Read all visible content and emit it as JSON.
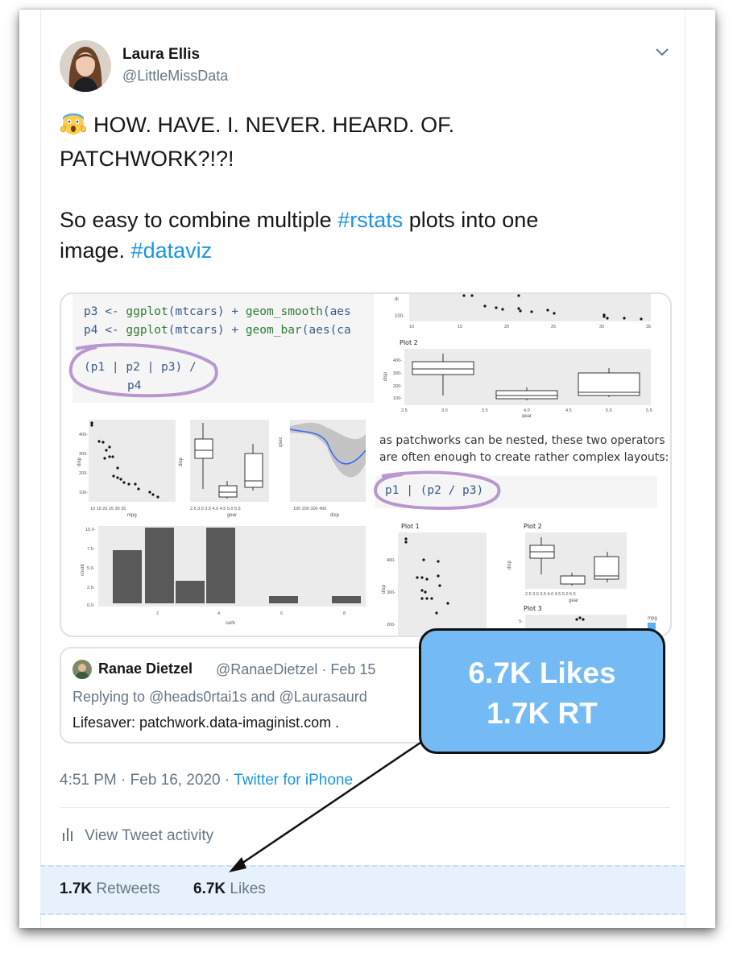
{
  "user": {
    "name": "Laura Ellis",
    "handle": "@LittleMissData",
    "avatar_icon": "profile-photo"
  },
  "tweet": {
    "emoji_icon": "screaming-face-emoji",
    "line1": "HOW. HAVE. I. NEVER. HEARD. OF.",
    "line2": "PATCHWORK?!?!",
    "para2_a": "So easy to combine multiple ",
    "hashtag1": "#rstats",
    "para2_b": " plots into one",
    "para2_c": "image. ",
    "hashtag2": "#dataviz"
  },
  "media": {
    "code1_p3_prefix": "p3 <- ",
    "code1_p3_fn": "ggplot",
    "code1_p3_mid": "(mtcars) + ",
    "code1_p3_geom": "geom_smooth",
    "code1_p3_tail": "(aes",
    "code1_p4_prefix": "p4 <- ",
    "code1_p4_fn": "ggplot",
    "code1_p4_mid": "(mtcars) + ",
    "code1_p4_geom": "geom_bar",
    "code1_p4_tail": "(aes(ca",
    "code2_line1": "(p1 | p2 | p3) /",
    "code2_line2": "p4",
    "prose_line1": "as patchworks can be nested, these two operators",
    "prose_line2": "are often enough to create rather complex layouts:",
    "code3": "p1 | (p2 / p3)",
    "plot2_title": "Plot 2",
    "plot1_title_b": "Plot 1",
    "plot2_title_b": "Plot 2",
    "plot3_title_b": "Plot 3",
    "legend_mpg": "mpg",
    "axis_mpg": "mpg",
    "axis_disp": "disp",
    "axis_gear": "gear",
    "axis_qsec": "qsec",
    "axis_count": "count",
    "axis_carb": "carb",
    "highlight_color": "#a77fc4"
  },
  "quote": {
    "name": "Ranae Dietzel",
    "meta": "@RanaeDietzel · Feb 15",
    "reply_prefix": "Replying to ",
    "reply_mentions": "@heads0rtai1s and @Laurasaurd",
    "text": "Lifesaver: patchwork.data-imaginist.com ."
  },
  "callout": {
    "line1": "6.7K Likes",
    "line2": "1.7K RT",
    "color": "#74bbf5"
  },
  "meta": {
    "time": "4:51 PM · Feb 16, 2020 · ",
    "source": "Twitter for iPhone",
    "activity": "View Tweet activity",
    "activity_icon": "bar-chart-icon"
  },
  "stats": {
    "retweets_count": "1.7K",
    "retweets_label": "Retweets",
    "likes_count": "6.7K",
    "likes_label": "Likes"
  }
}
